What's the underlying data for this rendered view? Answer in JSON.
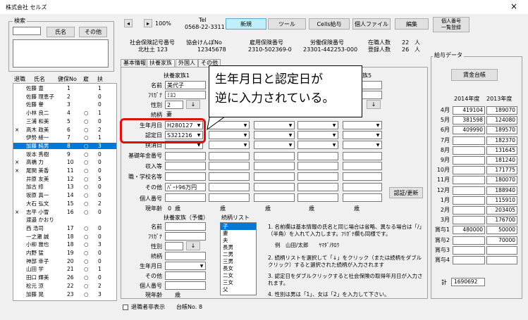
{
  "window": {
    "title": "株式会社 セルズ",
    "close": "×"
  },
  "search": {
    "group_label": "検索",
    "name_button": "氏名",
    "other_button": "その他"
  },
  "toolbar": {
    "zoom": "100%",
    "tel_label": "Tel",
    "tel_value": "0568-22-3311",
    "new_button": "新規",
    "tools_button": "ツール",
    "cells_salary_button": "Cells給与",
    "personal_file_button": "個人ファイル",
    "edit_button": "編集",
    "register_list_button": "個人番号\n一覧登録"
  },
  "header_info": {
    "social_ins_label": "社会保険記号番号",
    "social_ins_value": "北杜土 123",
    "kenpo_label": "協会けんぽNo",
    "kenpo_value": "12345678",
    "employment_label": "雇用保険番号",
    "employment_value": "2310-502369-0",
    "labor_label": "労働保険番号",
    "labor_value": "23301-442253-000",
    "current_label": "在職人数",
    "current_value": "22",
    "registered_label": "登録人数",
    "registered_value": "26",
    "unit": "人"
  },
  "tabs": [
    "基本情報",
    "扶養家族",
    "外国人",
    "その他"
  ],
  "employee_list": {
    "headers": [
      "退職",
      "氏名",
      "健保No",
      "雇",
      "扶"
    ],
    "rows": [
      {
        "ret": "",
        "name": "佐藤 豊",
        "no": "1",
        "koyo": "",
        "fu": "1"
      },
      {
        "ret": "",
        "name": "佐藤 理恵子",
        "no": "2",
        "koyo": "",
        "fu": "0"
      },
      {
        "ret": "",
        "name": "佐藤 譽",
        "no": "3",
        "koyo": "",
        "fu": "0"
      },
      {
        "ret": "",
        "name": "小林 良二",
        "no": "4",
        "koyo": "○",
        "fu": "1"
      },
      {
        "ret": "",
        "name": "三浦 和美",
        "no": "5",
        "koyo": "○",
        "fu": "0"
      },
      {
        "ret": "×",
        "name": "高木 政美",
        "no": "6",
        "koyo": "○",
        "fu": "2"
      },
      {
        "ret": "",
        "name": "伊勢 綾一",
        "no": "7",
        "koyo": "○",
        "fu": "1"
      },
      {
        "ret": "",
        "name": "加藤 純男",
        "no": "8",
        "koyo": "○",
        "fu": "3"
      },
      {
        "ret": "",
        "name": "坂本 秀樹",
        "no": "9",
        "koyo": "○",
        "fu": "0"
      },
      {
        "ret": "×",
        "name": "高橋 力",
        "no": "10",
        "koyo": "○",
        "fu": "0"
      },
      {
        "ret": "×",
        "name": "尾関 美香",
        "no": "11",
        "koyo": "○",
        "fu": "0"
      },
      {
        "ret": "",
        "name": "井原 友美",
        "no": "12",
        "koyo": "○",
        "fu": "5"
      },
      {
        "ret": "",
        "name": "加古 修",
        "no": "13",
        "koyo": "○",
        "fu": "0"
      },
      {
        "ret": "",
        "name": "坂原 真一",
        "no": "14",
        "koyo": "○",
        "fu": "0"
      },
      {
        "ret": "",
        "name": "大石 弘文",
        "no": "15",
        "koyo": "○",
        "fu": "2"
      },
      {
        "ret": "×",
        "name": "志平 小雪",
        "no": "16",
        "koyo": "○",
        "fu": "0"
      },
      {
        "ret": "",
        "name": "渡邉 かおり",
        "no": "",
        "koyo": "",
        "fu": ""
      },
      {
        "ret": "",
        "name": "西 浩司",
        "no": "17",
        "koyo": "○",
        "fu": "0"
      },
      {
        "ret": "",
        "name": "一之瀬 誠",
        "no": "18",
        "koyo": "○",
        "fu": "0"
      },
      {
        "ret": "",
        "name": "小柳 雅也",
        "no": "18",
        "koyo": "○",
        "fu": "3"
      },
      {
        "ret": "",
        "name": "内野 猛",
        "no": "19",
        "koyo": "○",
        "fu": "0"
      },
      {
        "ret": "",
        "name": "神部 幸子",
        "no": "20",
        "koyo": "○",
        "fu": "0"
      },
      {
        "ret": "",
        "name": "山田 学",
        "no": "21",
        "koyo": "○",
        "fu": "1"
      },
      {
        "ret": "",
        "name": "田口 輝美",
        "no": "26",
        "koyo": "○",
        "fu": "0"
      },
      {
        "ret": "",
        "name": "松元 涼",
        "no": "22",
        "koyo": "○",
        "fu": "2"
      },
      {
        "ret": "",
        "name": "加藤 晃",
        "no": "23",
        "koyo": "○",
        "fu": "3"
      }
    ]
  },
  "dependents": {
    "col1_header": "扶養家族1",
    "col5_header": "族5",
    "labels": {
      "name": "名前",
      "kana": "ﾌﾘｶﾞﾅ",
      "sex": "性別",
      "relation": "続柄",
      "birth": "生年月日",
      "cert": "認定日",
      "remove": "扶消日",
      "pension": "基礎年金番号",
      "income": "収入等",
      "job": "職・学校名等",
      "other": "その他",
      "mynumber": "個人番号",
      "age": "現年齢"
    },
    "name_value": "美代子",
    "kana_value": "ﾐﾖｺ",
    "sex_value": "2",
    "relation_value": "妻",
    "birth_value": "H280127",
    "cert_value": "S321216",
    "other_value": "ﾊﾟｰﾄ96万円",
    "age_value": "0",
    "age_unit": "歳",
    "cert_update_button": "認証/更新",
    "down_arrow": "↓"
  },
  "dependent_edit": {
    "header": "扶養家族（予備）",
    "list_label": "続柄リスト",
    "relations": [
      "子",
      "妻",
      "夫",
      "長男",
      "二男",
      "三男",
      "長女",
      "二女",
      "三女",
      "父"
    ],
    "notes": [
      "1. 名前欄は基本情報の氏名と同じ場合は省略、異なる場合は「/」（半角）を入れて入力します。ﾌﾘｶﾞﾅ欄も同様です。",
      "例　山田/太郎　　ﾔﾏﾀﾞ/ﾀﾛｳ",
      "2. 続柄リストを選択して「↓」をクリック（または続柄をダブルクリック）すると選択された続柄が入力されます",
      "3. 認定日をダブルクリックすると社会保険の取得年月日が入力されます。",
      "4. 性別は男は「1」、女は「2」を入力して下さい。"
    ]
  },
  "salary": {
    "group_label": "給与データ",
    "ledger_button": "賃金台帳",
    "col1": "2014年度",
    "col2": "2013年度",
    "rows": [
      {
        "m": "4月",
        "a": "419104",
        "b": "189070"
      },
      {
        "m": "5月",
        "a": "381598",
        "b": "124080"
      },
      {
        "m": "6月",
        "a": "409990",
        "b": "189570"
      },
      {
        "m": "7月",
        "a": "",
        "b": "182370"
      },
      {
        "m": "8月",
        "a": "",
        "b": "131645"
      },
      {
        "m": "9月",
        "a": "",
        "b": "181240"
      },
      {
        "m": "10月",
        "a": "",
        "b": "171775"
      },
      {
        "m": "11月",
        "a": "",
        "b": "180070"
      },
      {
        "m": "12月",
        "a": "",
        "b": "188940"
      },
      {
        "m": "1月",
        "a": "",
        "b": "115910"
      },
      {
        "m": "2月",
        "a": "",
        "b": "203405"
      },
      {
        "m": "3月",
        "a": "",
        "b": "176700"
      },
      {
        "m": "賞与1",
        "a": "480000",
        "b": "50000"
      },
      {
        "m": "賞与2",
        "a": "",
        "b": "70000"
      },
      {
        "m": "賞与3",
        "a": "",
        "b": ""
      },
      {
        "m": "賞与4",
        "a": "",
        "b": ""
      }
    ],
    "total_label": "計",
    "total_value": "1690692"
  },
  "footer": {
    "hide_retired": "退職者非表示",
    "daicho_label": "台帳No.",
    "daicho_value": "8"
  },
  "callout": {
    "line1": "生年月日と認定日が",
    "line2": "逆に入力されている。"
  }
}
